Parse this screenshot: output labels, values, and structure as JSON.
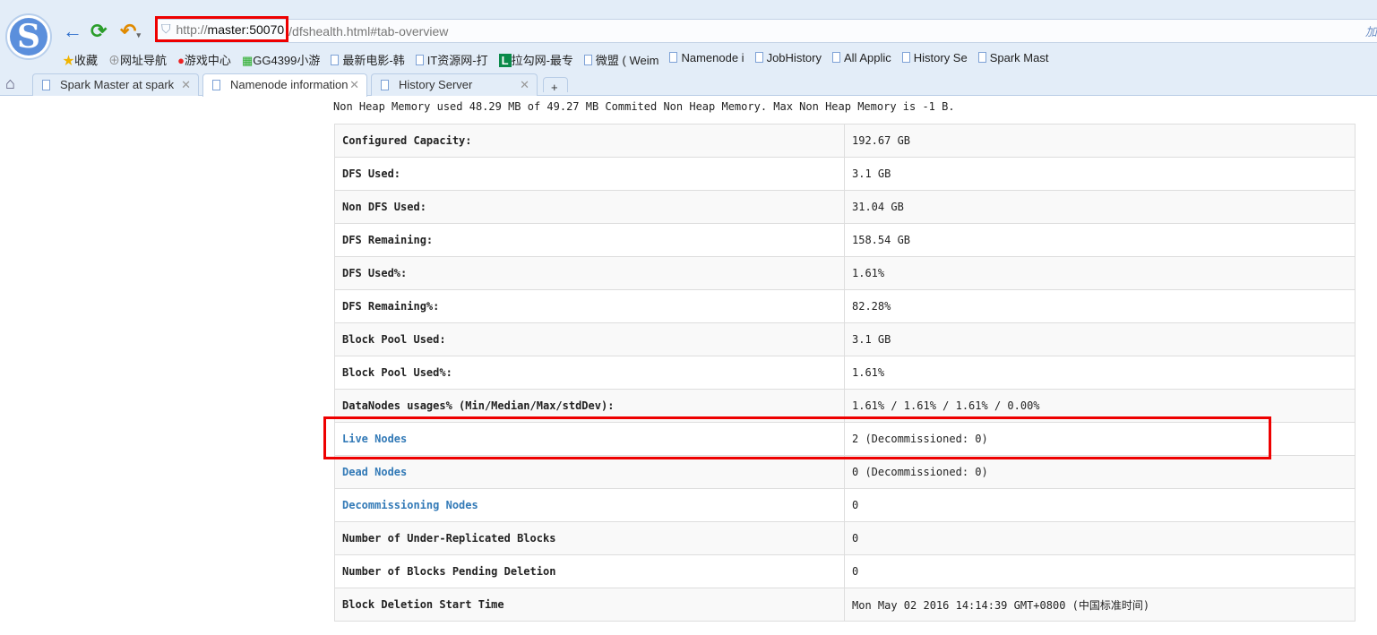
{
  "browser": {
    "url_host": "http://master:50070",
    "url_path": "/dfshealth.html#tab-overview",
    "addr_right": "加",
    "bookmarks": [
      "收藏",
      "网址导航",
      "游戏中心",
      "GG4399小游",
      "最新电影-韩",
      "IT资源网-打",
      "拉勾网-最专",
      "微盟 ( Weim",
      "Namenode i",
      "JobHistory",
      "All Applic",
      "History Se",
      "Spark Mast"
    ],
    "tabs": [
      {
        "label": "Spark Master at spark"
      },
      {
        "label": "Namenode information"
      },
      {
        "label": "History Server"
      }
    ],
    "new_tab": "+"
  },
  "page": {
    "heap_text": "Non Heap Memory used 48.29 MB of 49.27 MB Commited Non Heap Memory. Max Non Heap Memory is -1 B.",
    "rows": [
      {
        "label": "Configured Capacity:",
        "value": "192.67 GB"
      },
      {
        "label": "DFS Used:",
        "value": "3.1 GB"
      },
      {
        "label": "Non DFS Used:",
        "value": "31.04 GB"
      },
      {
        "label": "DFS Remaining:",
        "value": "158.54 GB"
      },
      {
        "label": "DFS Used%:",
        "value": "1.61%"
      },
      {
        "label": "DFS Remaining%:",
        "value": "82.28%"
      },
      {
        "label": "Block Pool Used:",
        "value": "3.1 GB"
      },
      {
        "label": "Block Pool Used%:",
        "value": "1.61%"
      },
      {
        "label": "DataNodes usages% (Min/Median/Max/stdDev):",
        "value": "1.61% / 1.61% / 1.61% / 0.00%"
      },
      {
        "label": "Live Nodes",
        "value": "2 (Decommissioned: 0)"
      },
      {
        "label": "Dead Nodes",
        "value": "0 (Decommissioned: 0)"
      },
      {
        "label": "Decommissioning Nodes",
        "value": "0"
      },
      {
        "label": "Number of Under-Replicated Blocks",
        "value": "0"
      },
      {
        "label": "Number of Blocks Pending Deletion",
        "value": "0"
      },
      {
        "label": "Block Deletion Start Time",
        "value": "Mon May 02 2016 14:14:39 GMT+0800 (中国标准时间)"
      }
    ]
  },
  "colors": {
    "link": "#337ab7",
    "highlight": "#e00000"
  }
}
